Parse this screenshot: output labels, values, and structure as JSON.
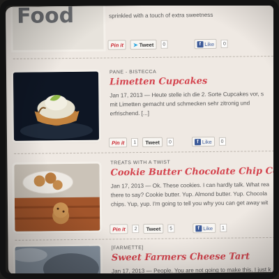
{
  "top_post": {
    "thumb_text": "Food",
    "excerpt": "sprinkled with a touch of extra sweetness",
    "share": {
      "pin": "Pin it",
      "pin_count": "",
      "tweet": "Tweet",
      "tweet_count": "0",
      "like": "Like",
      "like_count": "0"
    }
  },
  "posts": [
    {
      "category": "PANE - BISTECCA",
      "title": "Limetten Cupcakes",
      "excerpt": [
        "Jan 17, 2013 — Heute stelle ich die 2. Sorte Cupcakes vor, s",
        "mit Limetten gemacht und schmecken sehr zitronig und",
        "erfrischend. [...]"
      ],
      "share": {
        "pin": "Pin it",
        "pin_count": "1",
        "tweet": "Tweet",
        "tweet_count": "0",
        "like": "Like",
        "like_count": "0"
      }
    },
    {
      "category": "TREATS WITH A TWIST",
      "title": "Cookie Butter Chocolate Chip Cookies",
      "excerpt": [
        "Jan 17, 2013 — Ok. These cookies. I can hardly talk. What rea",
        "there to say? Cookie butter. Yup. Almond butter. Yup. Chocola",
        "chips. Yup, yup. I'm going to tell you why you can get away wit"
      ],
      "share": {
        "pin": "Pin it",
        "pin_count": "2",
        "tweet": "Tweet",
        "tweet_count": "5",
        "like": "Like",
        "like_count": "1"
      }
    },
    {
      "category": "[FARMETTE]",
      "title": "Sweet Farmers Cheese Tart",
      "excerpt": [
        "Jan 17, 2013 — People. You are not going to make this. I just k"
      ],
      "share": null
    }
  ],
  "colors": {
    "title": "#d4434d",
    "pin": "#c8232c",
    "facebook": "#3b5998",
    "twitter": "#2aa6e0",
    "page_bg": "#efe9e3"
  }
}
